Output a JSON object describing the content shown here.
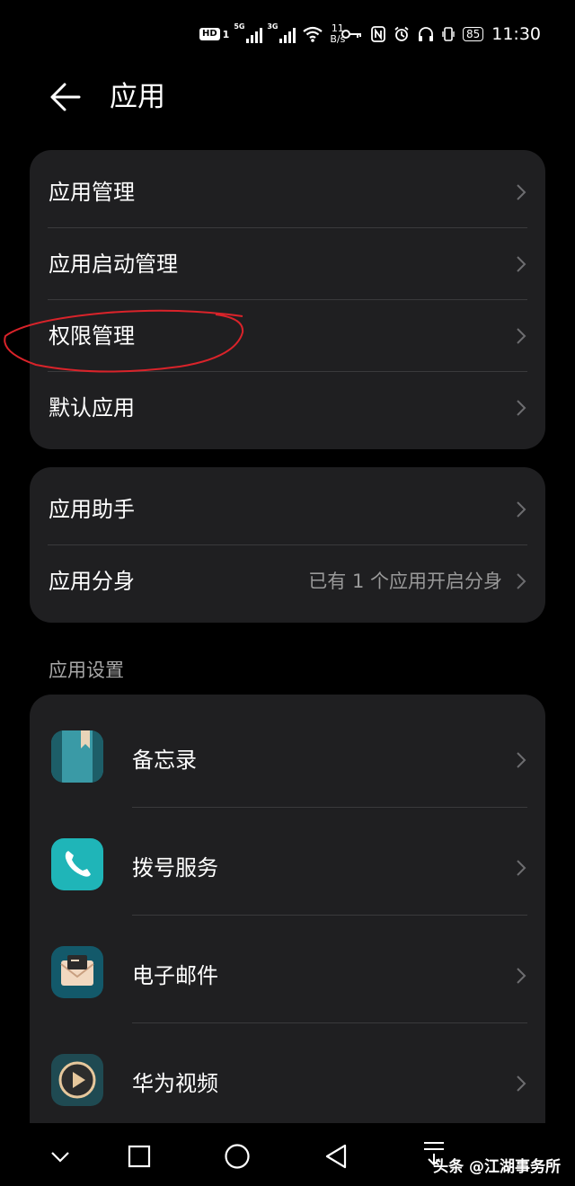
{
  "status_bar": {
    "network_speed_value": "11",
    "network_speed_unit": "B/s",
    "signal_1": "5G",
    "signal_2": "3G",
    "sim": "1",
    "hd": "HD",
    "battery": "85",
    "time": "11:30"
  },
  "header": {
    "title": "应用"
  },
  "group1": {
    "items": [
      {
        "label": "应用管理"
      },
      {
        "label": "应用启动管理"
      },
      {
        "label": "权限管理"
      },
      {
        "label": "默认应用"
      }
    ]
  },
  "group2": {
    "items": [
      {
        "label": "应用助手",
        "value": ""
      },
      {
        "label": "应用分身",
        "value": "已有 1 个应用开启分身"
      }
    ]
  },
  "app_settings": {
    "section_title": "应用设置",
    "apps": [
      {
        "label": "备忘录",
        "icon": "notepad-icon"
      },
      {
        "label": "拨号服务",
        "icon": "phone-icon"
      },
      {
        "label": "电子邮件",
        "icon": "email-icon"
      },
      {
        "label": "华为视频",
        "icon": "video-icon"
      }
    ]
  },
  "watermark": "头条 @江湖事务所",
  "annotation_color": "#d9232a"
}
